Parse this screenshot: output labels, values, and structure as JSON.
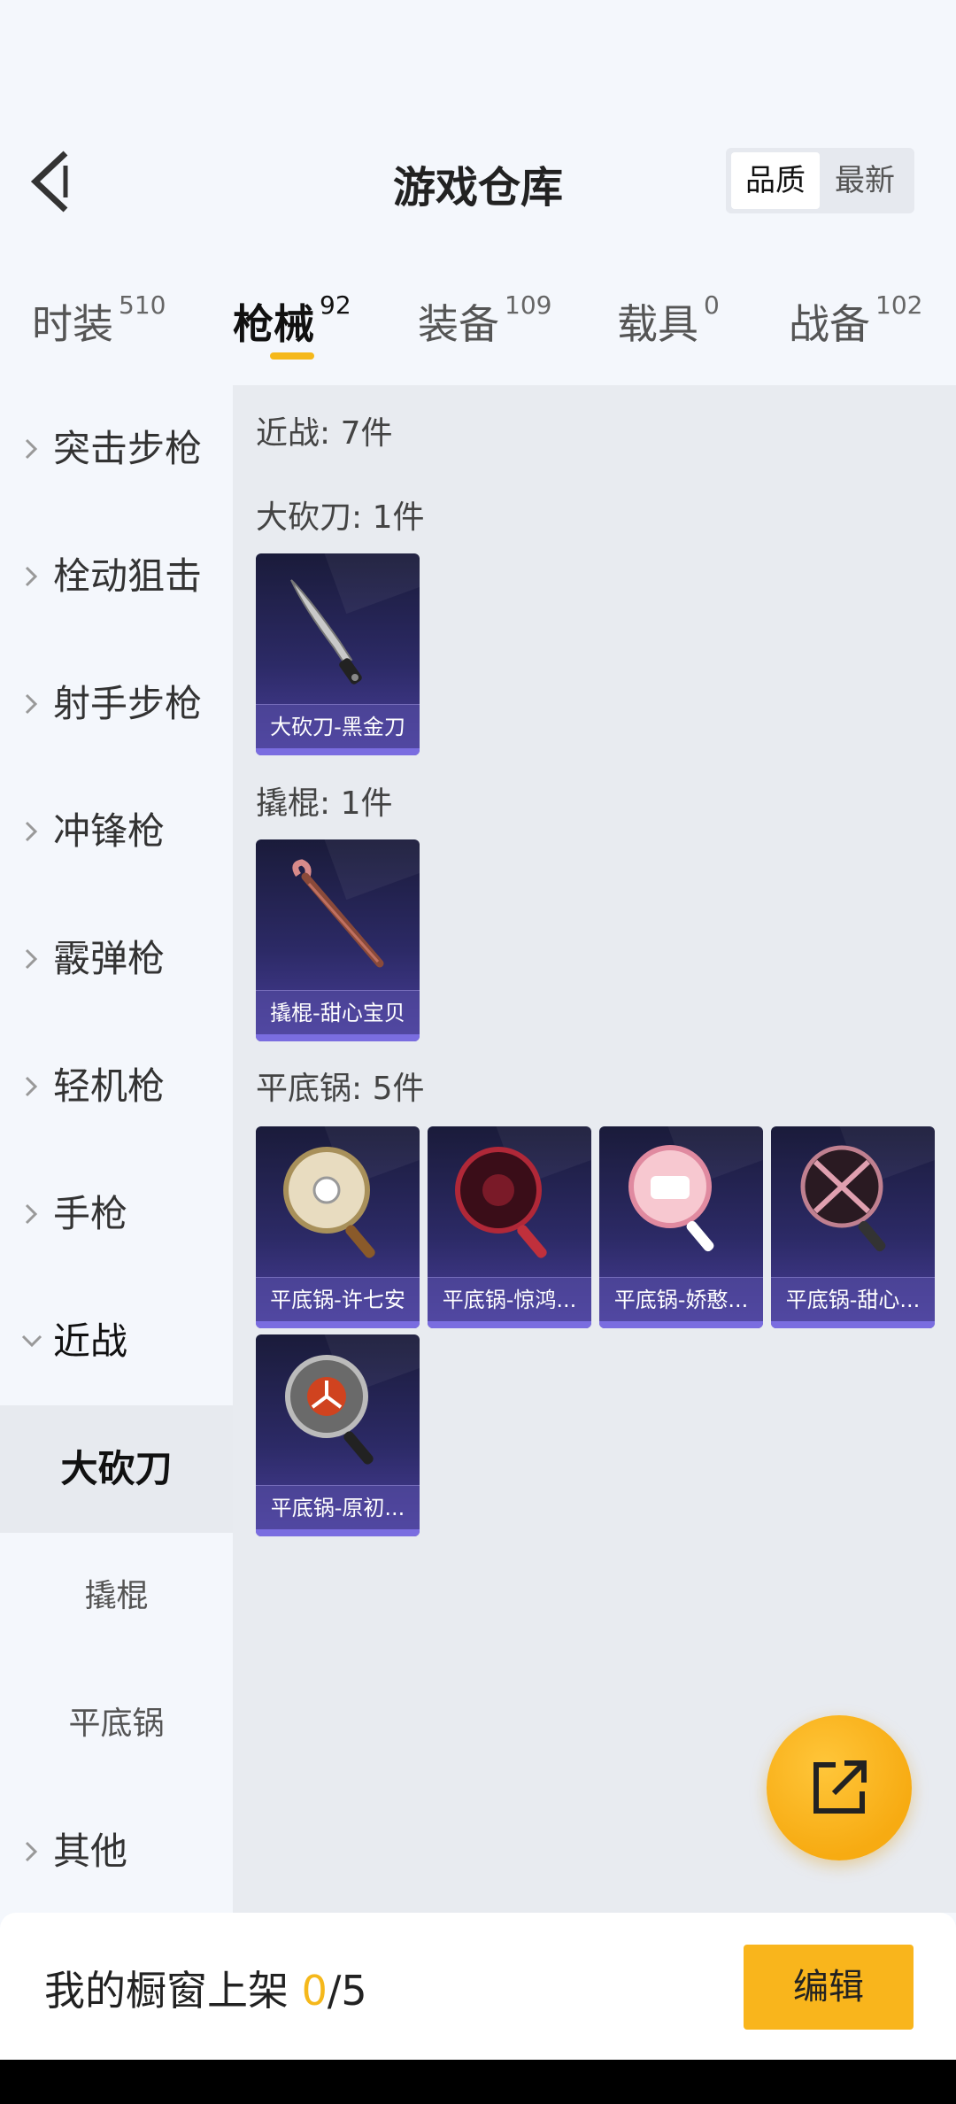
{
  "header": {
    "title": "游戏仓库",
    "sort_options": [
      "品质",
      "最新"
    ],
    "sort_active": "品质"
  },
  "tabs": [
    {
      "label": "时装",
      "count": "510"
    },
    {
      "label": "枪械",
      "count": "92"
    },
    {
      "label": "装备",
      "count": "109"
    },
    {
      "label": "载具",
      "count": "0"
    },
    {
      "label": "战备",
      "count": "102"
    }
  ],
  "active_tab": "枪械",
  "sidebar": {
    "items": [
      "突击步枪",
      "栓动狙击",
      "射手步枪",
      "冲锋枪",
      "霰弹枪",
      "轻机枪",
      "手枪",
      "近战"
    ],
    "sub_items": [
      "大砍刀",
      "撬棍",
      "平底锅"
    ],
    "after": "其他",
    "active_sub": "大砍刀"
  },
  "content": {
    "category_total": "近战: 7件",
    "groups": [
      {
        "title": "大砍刀: 1件",
        "items": [
          "大砍刀-黑金刀"
        ]
      },
      {
        "title": "撬棍: 1件",
        "items": [
          "撬棍-甜心宝贝"
        ]
      },
      {
        "title": "平底锅: 5件",
        "items": [
          "平底锅-许七安",
          "平底锅-惊鸿...",
          "平底锅-娇憨...",
          "平底锅-甜心...",
          "平底锅-原初..."
        ]
      }
    ]
  },
  "bottom": {
    "label": "我的橱窗上架",
    "listed": "0",
    "total": "/5",
    "edit_label": "编辑"
  },
  "colors": {
    "accent": "#f5b81b",
    "card_dark": "#1a1b3a",
    "card_light": "#4a3f9c"
  }
}
